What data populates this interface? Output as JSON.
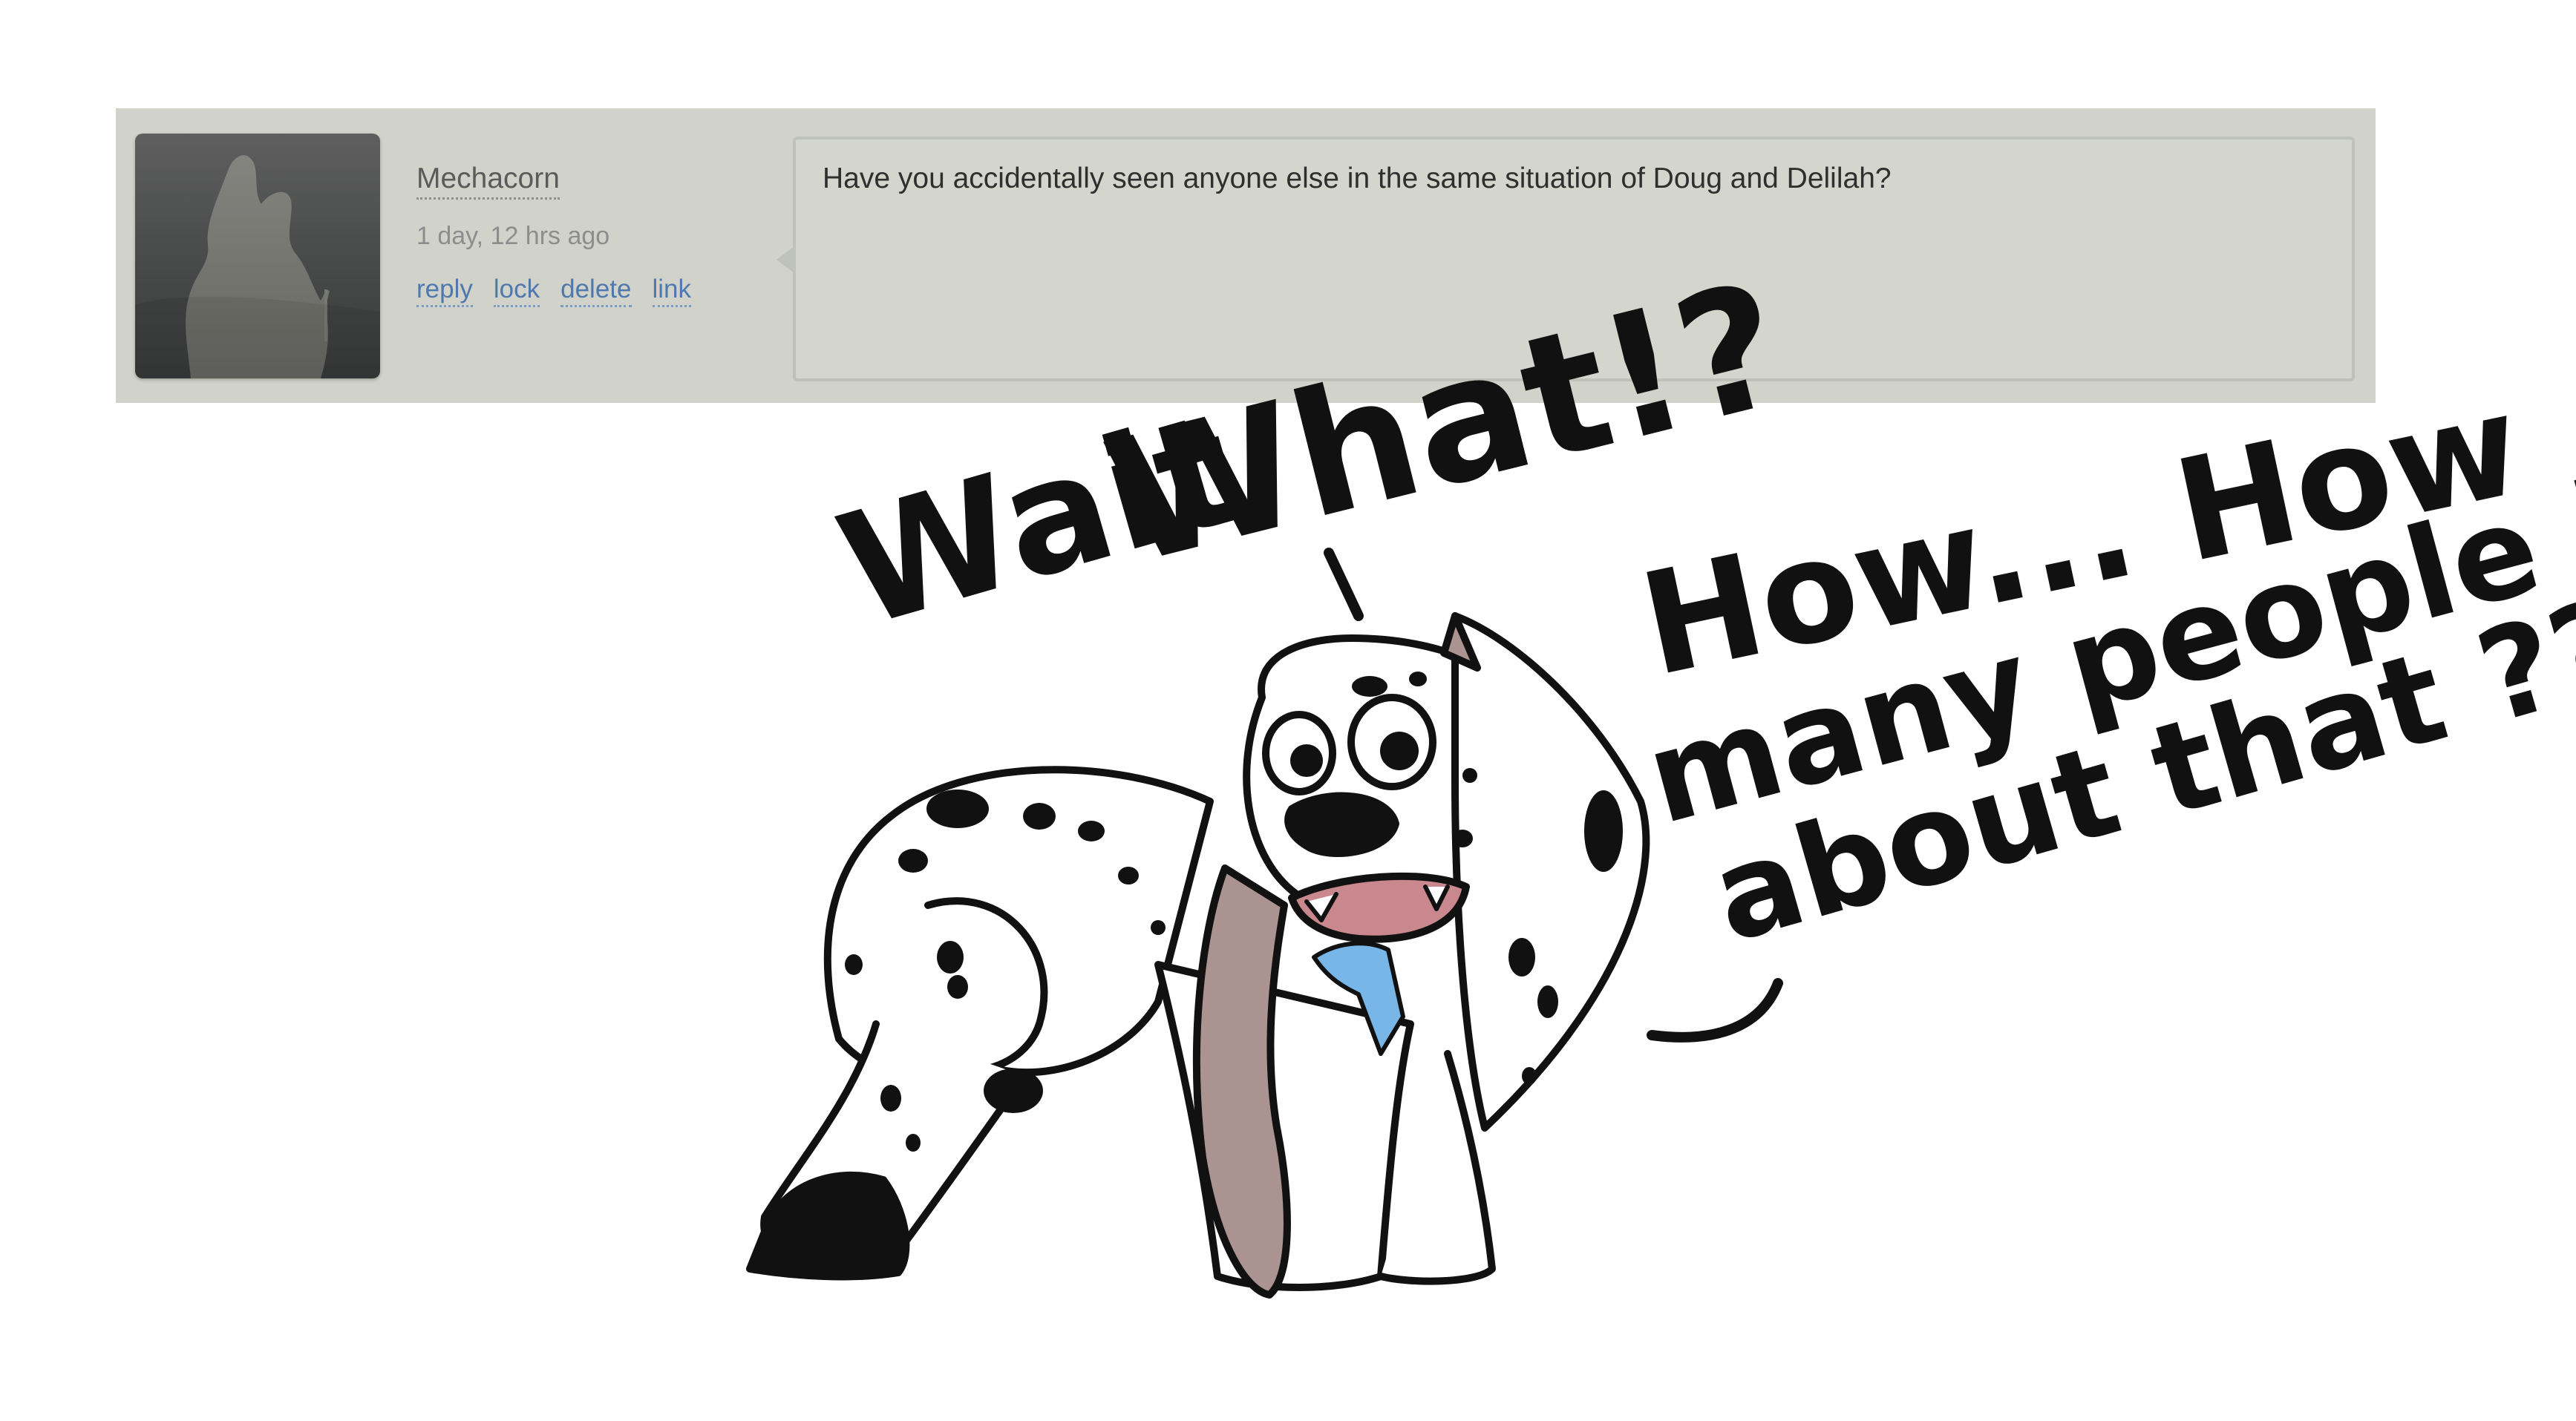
{
  "comment": {
    "avatar": "user-avatar-silhouette",
    "username": "Mechacorn",
    "timestamp": "1 day, 12 hrs ago",
    "actions": [
      "reply",
      "lock",
      "delete",
      "link"
    ],
    "message": "Have you accidentally seen anyone else in the same situation of Doug and Delilah?"
  },
  "handwriting": {
    "line1": "Wait",
    "line2": "What!?",
    "line3": "How... How",
    "line4": "many people know",
    "line5": "about that ??"
  },
  "colors": {
    "panel_bg": "#d1d3ca",
    "link": "#4f79ae",
    "ear": "#ab9392",
    "mouth": "#c9888d",
    "collar": "#79b6e8",
    "ink": "#111111"
  }
}
